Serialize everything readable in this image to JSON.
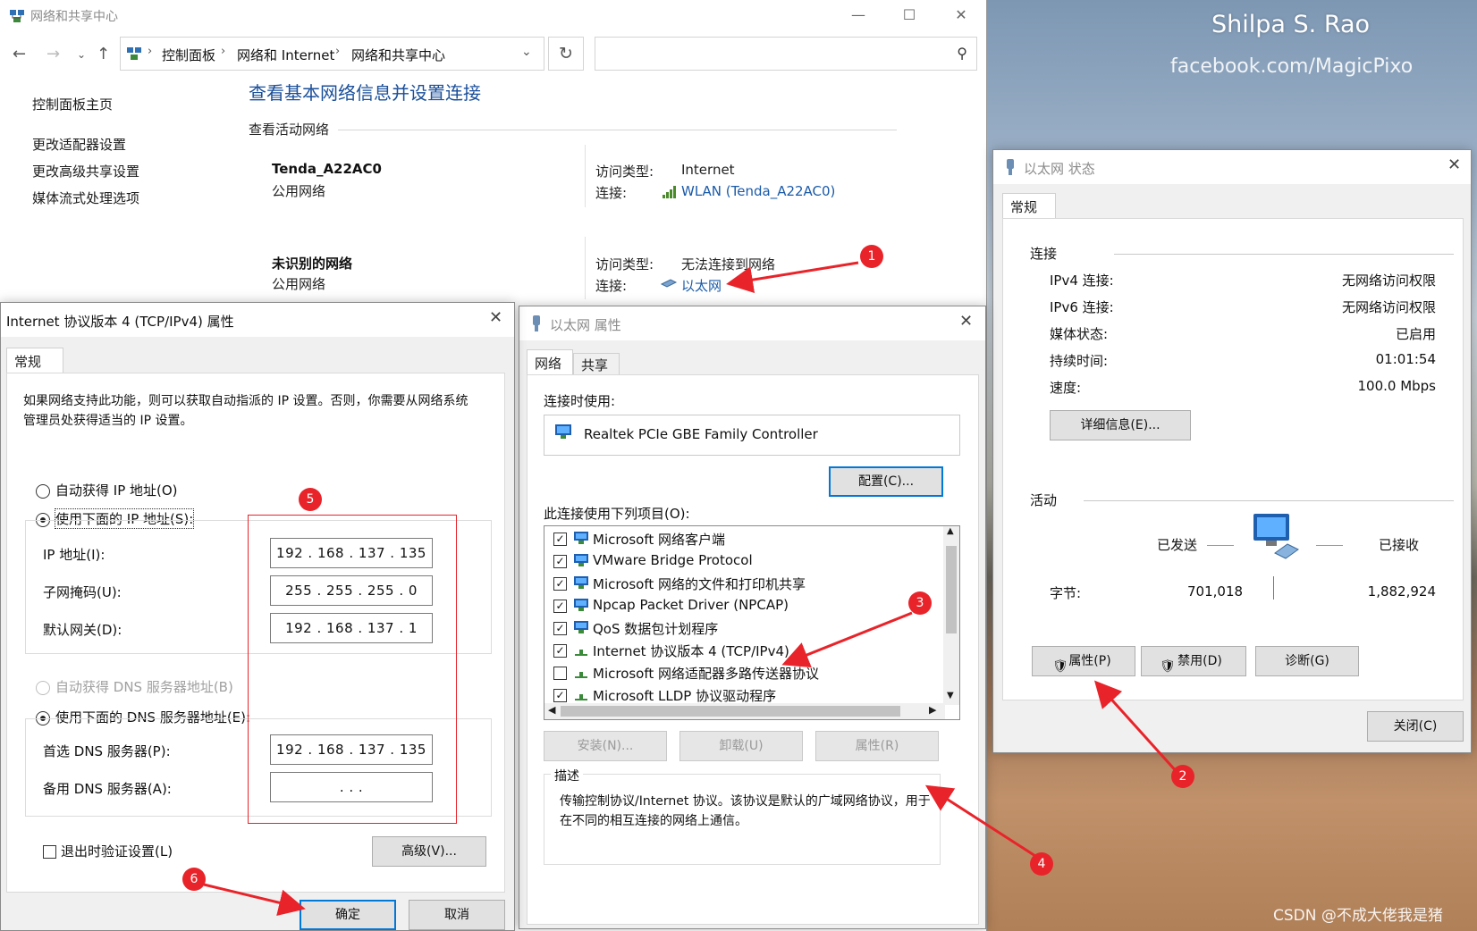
{
  "watermark": {
    "line1": "Shilpa S. Rao",
    "line2": "facebook.com/MagicPixo",
    "credit": "CSDN @不成大佬我是猪"
  },
  "main": {
    "title": "网络和共享中心",
    "breadcrumb": [
      "控制面板",
      "网络和 Internet",
      "网络和共享中心"
    ],
    "sidebar": [
      "控制面板主页",
      "更改适配器设置",
      "更改高级共享设置",
      "媒体流式处理选项"
    ],
    "page_title": "查看基本网络信息并设置连接",
    "active_networks_label": "查看活动网络",
    "networks": [
      {
        "name": "Tenda_A22AC0",
        "type": "公用网络",
        "access_label": "访问类型:",
        "access": "Internet",
        "conn_label": "连接:",
        "conn": "WLAN (Tenda_A22AC0)"
      },
      {
        "name": "未识别的网络",
        "type": "公用网络",
        "access_label": "访问类型:",
        "access": "无法连接到网络",
        "conn_label": "连接:",
        "conn": "以太网"
      }
    ]
  },
  "status": {
    "title": "以太网 状态",
    "tab": "常规",
    "conn_section": "连接",
    "rows": [
      {
        "k": "IPv4 连接:",
        "v": "无网络访问权限"
      },
      {
        "k": "IPv6 连接:",
        "v": "无网络访问权限"
      },
      {
        "k": "媒体状态:",
        "v": "已启用"
      },
      {
        "k": "持续时间:",
        "v": "01:01:54"
      },
      {
        "k": "速度:",
        "v": "100.0 Mbps"
      }
    ],
    "details_btn": "详细信息(E)...",
    "activity_section": "活动",
    "sent_label": "已发送",
    "received_label": "已接收",
    "bytes_label": "字节:",
    "bytes_sent": "701,018",
    "bytes_received": "1,882,924",
    "btn_properties": "属性(P)",
    "btn_disable": "禁用(D)",
    "btn_diagnose": "诊断(G)",
    "btn_close": "关闭(C)"
  },
  "eth_props": {
    "title": "以太网 属性",
    "tab_network": "网络",
    "tab_share": "共享",
    "connect_using_label": "连接时使用:",
    "adapter": "Realtek PCIe GBE Family Controller",
    "config_btn": "配置(C)...",
    "items_label": "此连接使用下列项目(O):",
    "items": [
      {
        "label": "Microsoft 网络客户端",
        "checked": true,
        "icon": "network-client-icon"
      },
      {
        "label": "VMware Bridge Protocol",
        "checked": true,
        "icon": "network-client-icon"
      },
      {
        "label": "Microsoft 网络的文件和打印机共享",
        "checked": true,
        "icon": "network-client-icon"
      },
      {
        "label": "Npcap Packet Driver (NPCAP)",
        "checked": true,
        "icon": "network-client-icon"
      },
      {
        "label": "QoS 数据包计划程序",
        "checked": true,
        "icon": "network-client-icon"
      },
      {
        "label": "Internet 协议版本 4 (TCP/IPv4)",
        "checked": true,
        "icon": "protocol-icon"
      },
      {
        "label": "Microsoft 网络适配器多路传送器协议",
        "checked": false,
        "icon": "protocol-icon"
      },
      {
        "label": "Microsoft LLDP 协议驱动程序",
        "checked": true,
        "icon": "protocol-icon"
      }
    ],
    "install_btn": "安装(N)...",
    "uninstall_btn": "卸载(U)",
    "properties_btn": "属性(R)",
    "desc_label": "描述",
    "desc_text": "传输控制协议/Internet 协议。该协议是默认的广域网络协议，用于在不同的相互连接的网络上通信。"
  },
  "ipv4": {
    "title": "Internet 协议版本 4 (TCP/IPv4) 属性",
    "tab": "常规",
    "intro": "如果网络支持此功能，则可以获取自动指派的 IP 设置。否则，你需要从网络系统管理员处获得适当的 IP 设置。",
    "auto_ip": "自动获得 IP 地址(O)",
    "manual_ip": "使用下面的 IP 地址(S):",
    "ip_label": "IP 地址(I):",
    "ip_value": "192 . 168 . 137 . 135",
    "mask_label": "子网掩码(U):",
    "mask_value": "255 . 255 . 255 .   0",
    "gw_label": "默认网关(D):",
    "gw_value": "192 . 168 . 137 .   1",
    "auto_dns": "自动获得 DNS 服务器地址(B)",
    "manual_dns": "使用下面的 DNS 服务器地址(E):",
    "dns1_label": "首选 DNS 服务器(P):",
    "dns1_value": "192 . 168 . 137 . 135",
    "dns2_label": "备用 DNS 服务器(A):",
    "dns2_value": ".      .      .",
    "validate": "退出时验证设置(L)",
    "advanced_btn": "高级(V)...",
    "ok_btn": "确定",
    "cancel_btn": "取消"
  },
  "annotations": [
    "1",
    "2",
    "3",
    "4",
    "5",
    "6"
  ],
  "colors": {
    "accent": "#e8242a",
    "link": "#1a5aa8",
    "title_blue": "#1a4f9a",
    "focus": "#0078d7"
  }
}
